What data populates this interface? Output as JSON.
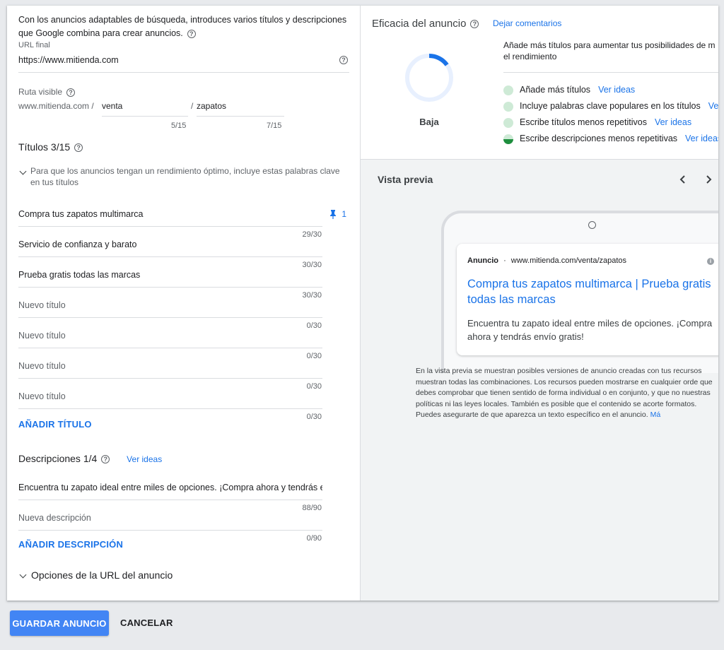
{
  "form": {
    "intro": "Con los anuncios adaptables de búsqueda, introduces varios títulos y descripciones que Google combina para crear anuncios.",
    "final_url_label": "URL final",
    "final_url_value": "https://www.mitienda.com",
    "display_path_label": "Ruta visible",
    "display_domain": "www.mitienda.com /",
    "path1": "venta",
    "path_sep": "/",
    "path2": "zapatos",
    "path1_count": "5/15",
    "path2_count": "7/15",
    "headlines_label": "Títulos 3/15",
    "keywords_hint": "Para que los anuncios tengan un rendimiento óptimo, incluye estas palabras clave en tus títulos",
    "pin_count": "1",
    "headlines": [
      {
        "value": "Compra tus zapatos multimarca",
        "placeholder": "",
        "count": "29/30"
      },
      {
        "value": "Servicio de confianza y barato",
        "placeholder": "",
        "count": "30/30"
      },
      {
        "value": "Prueba gratis todas las marcas",
        "placeholder": "",
        "count": "30/30"
      },
      {
        "value": "",
        "placeholder": "Nuevo título",
        "count": "0/30"
      },
      {
        "value": "",
        "placeholder": "Nuevo título",
        "count": "0/30"
      },
      {
        "value": "",
        "placeholder": "Nuevo título",
        "count": "0/30"
      },
      {
        "value": "",
        "placeholder": "Nuevo título",
        "count": "0/30"
      }
    ],
    "add_headline": "AÑADIR TÍTULO",
    "descriptions_label": "Descripciones 1/4",
    "see_ideas": "Ver ideas",
    "descriptions": [
      {
        "value": "Encuentra tu zapato ideal entre miles de opciones. ¡Compra ahora y tendrás en",
        "placeholder": "",
        "count": "88/90"
      },
      {
        "value": "",
        "placeholder": "Nueva descripción",
        "count": "0/90"
      }
    ],
    "add_description": "AÑADIR DESCRIPCIÓN",
    "url_options": "Opciones de la URL del anuncio"
  },
  "strength": {
    "title": "Eficacia del anuncio",
    "feedback": "Dejar comentarios",
    "rating": "Baja",
    "rating_fraction": 0.15,
    "summary": "Añade más títulos para aumentar tus posibilidades de m el rendimiento",
    "tips": [
      {
        "text": "Añade más títulos",
        "link": "Ver ideas",
        "state": "empty"
      },
      {
        "text": "Incluye palabras clave populares en los títulos",
        "link": "Ver",
        "state": "empty"
      },
      {
        "text": "Escribe títulos menos repetitivos",
        "link": "Ver ideas",
        "state": "empty"
      },
      {
        "text": "Escribe descripciones menos repetitivas",
        "link": "Ver ideas",
        "state": "half"
      }
    ]
  },
  "preview": {
    "title": "Vista previa",
    "ad_label": "Anuncio",
    "ad_url": "www.mitienda.com/venta/zapatos",
    "ad_headline": "Compra tus zapatos multimarca | Prueba gratis todas las marcas",
    "ad_description": "Encuentra tu zapato ideal entre miles de opciones. ¡Compra ahora y tendrás envío gratis!",
    "disclaimer": "En la vista previa se muestran posibles versiones de anuncio creadas con tus recursos muestran todas las combinaciones. Los recursos pueden mostrarse en cualquier orde que debes comprobar que tienen sentido de forma individual o en conjunto, y que no nuestras políticas ni las leyes locales. También es posible que el contenido se acorte formatos. Puedes asegurarte de que aparezca un texto específico en el anuncio.",
    "more_link": "Má"
  },
  "footer": {
    "save": "GUARDAR ANUNCIO",
    "cancel": "CANCELAR"
  },
  "colors": {
    "accent": "#1a73e8",
    "primary_button": "#4285f4",
    "tip_empty": "#ceead6",
    "tip_fill": "#1e8e3e"
  }
}
